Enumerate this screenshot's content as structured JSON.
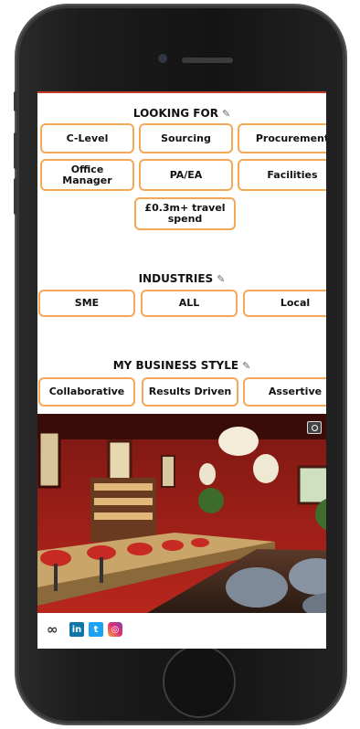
{
  "looking_for": {
    "title": "LOOKING FOR",
    "tags": [
      "C-Level",
      "Sourcing",
      "Procurement",
      "Office Manager",
      "PA/EA",
      "Facilities",
      "£0.3m+ travel spend"
    ]
  },
  "industries": {
    "title": "INDUSTRIES",
    "tags": [
      "SME",
      "ALL",
      "Local"
    ]
  },
  "business_style": {
    "title": "MY BUSINESS STYLE",
    "tags": [
      "Collaborative",
      "Results Driven",
      "Assertive"
    ]
  },
  "icons": {
    "edit": "pencil-icon",
    "photo_badge": "camera-icon",
    "social": [
      "link-icon",
      "linkedin-icon",
      "twitter-icon",
      "instagram-icon"
    ]
  },
  "social_glyphs": {
    "linkedin": "in",
    "twitter": "t",
    "instagram": "◎",
    "link": "∞"
  },
  "colors": {
    "tag_border": "#f5a855",
    "accent_line": "#c0392b"
  }
}
